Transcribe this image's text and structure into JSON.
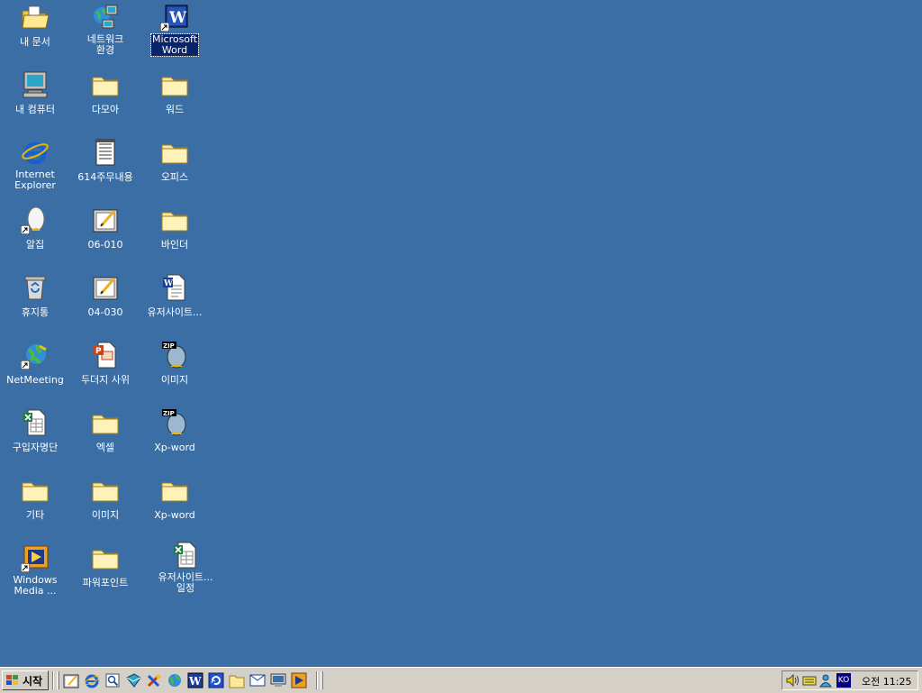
{
  "desktop": {
    "icons": [
      {
        "label": "내 문서"
      },
      {
        "label": "네트워크\n환경"
      },
      {
        "label": "Microsoft\nWord"
      },
      {
        "label": "내 컴퓨터"
      },
      {
        "label": "다모아"
      },
      {
        "label": "워드"
      },
      {
        "label": "Internet\nExplorer"
      },
      {
        "label": "614주무내용"
      },
      {
        "label": "오피스"
      },
      {
        "label": "알집"
      },
      {
        "label": "06-010"
      },
      {
        "label": "바인더"
      },
      {
        "label": "휴지통"
      },
      {
        "label": "04-030"
      },
      {
        "label": "유저사이트..."
      },
      {
        "label": "NetMeeting"
      },
      {
        "label": "두더지 사위"
      },
      {
        "label": "이미지"
      },
      {
        "label": "구입자명단"
      },
      {
        "label": "엑셀"
      },
      {
        "label": "Xp-word"
      },
      {
        "label": "기타"
      },
      {
        "label": "이미지"
      },
      {
        "label": "Xp-word"
      },
      {
        "label": "Windows\nMedia ..."
      },
      {
        "label": "파워포인트"
      },
      {
        "label": "유저사이트...\n일정"
      }
    ]
  },
  "taskbar": {
    "start_label": "시작",
    "tray_lang": "KO",
    "clock": "오전 11:25"
  },
  "colors": {
    "desktop": "#3a6ea5",
    "taskbar": "#d4d0c8",
    "selection": "#0a246a"
  }
}
